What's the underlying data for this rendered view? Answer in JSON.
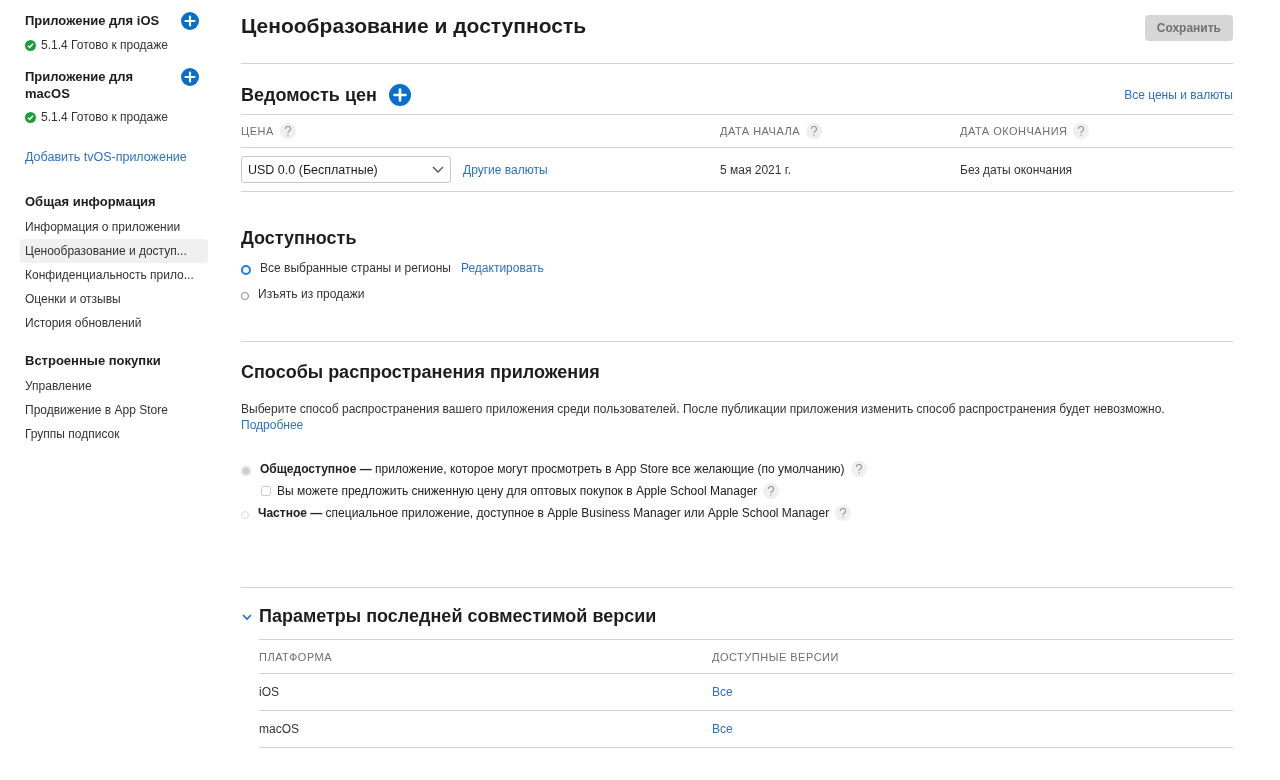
{
  "sidebar": {
    "apps": [
      {
        "title": "Приложение для iOS",
        "status": "5.1.4 Готово к продаже"
      },
      {
        "title": "Приложение для macOS",
        "status": "5.1.4 Готово к продаже"
      }
    ],
    "add_link": "Добавить tvOS-приложение",
    "groups": [
      {
        "heading": "Общая информация",
        "items": [
          {
            "label": "Информация о приложении",
            "selected": false
          },
          {
            "label": "Ценообразование и доступ...",
            "selected": true
          },
          {
            "label": "Конфиденциальность прило...",
            "selected": false
          },
          {
            "label": "Оценки и отзывы",
            "selected": false
          },
          {
            "label": "История обновлений",
            "selected": false
          }
        ]
      },
      {
        "heading": "Встроенные покупки",
        "items": [
          {
            "label": "Управление",
            "selected": false
          },
          {
            "label": "Продвижение в App Store",
            "selected": false
          },
          {
            "label": "Группы подписок",
            "selected": false
          }
        ]
      }
    ]
  },
  "page": {
    "title": "Ценообразование и доступность",
    "save_button": {
      "label": "Сохранить",
      "disabled": true
    }
  },
  "price_schedule": {
    "title": "Ведомость цен",
    "all_link": "Все цены и валюты",
    "columns": [
      "ЦЕНА",
      "ДАТА НАЧАЛА",
      "ДАТА ОКОНЧАНИЯ"
    ],
    "row": {
      "price": "USD 0.0 (Бесплатные)",
      "other_link": "Другие валюты",
      "start": "5 мая 2021 г.",
      "end": "Без даты окончания"
    }
  },
  "availability": {
    "title": "Доступность",
    "options": [
      {
        "label": "Все выбранные страны и регионы",
        "link": "Редактировать",
        "selected": true
      },
      {
        "label": "Изъять из продажи",
        "selected": false
      }
    ]
  },
  "distribution": {
    "title": "Способы распространения приложения",
    "description": "Выберите способ распространения вашего приложения среди пользователей. После публикации приложения изменить способ распространения будет невозможно.",
    "more_link": "Подробнее",
    "options": [
      {
        "kind": "radio",
        "label": "**Общедоступное —** приложение, которое могут просмотреть в App Store все желающие (по умолчанию)",
        "selected": true,
        "disabled": true
      },
      {
        "kind": "checkbox",
        "label": "Вы можете предложить сниженную цену для оптовых покупок в Apple School Manager",
        "checked": false,
        "disabled": true
      },
      {
        "kind": "radio",
        "label": "**Частное —** специальное приложение, доступное в Apple Business Manager или Apple School Manager",
        "selected": false,
        "disabled": true
      }
    ]
  },
  "compat": {
    "title": "Параметры последней совместимой версии",
    "expanded": true,
    "columns": [
      "ПЛАТФОРМА",
      "ДОСТУПНЫЕ ВЕРСИИ"
    ],
    "rows": [
      {
        "platform": "iOS",
        "versions": "Все"
      },
      {
        "platform": "macOS",
        "versions": "Все"
      }
    ]
  }
}
